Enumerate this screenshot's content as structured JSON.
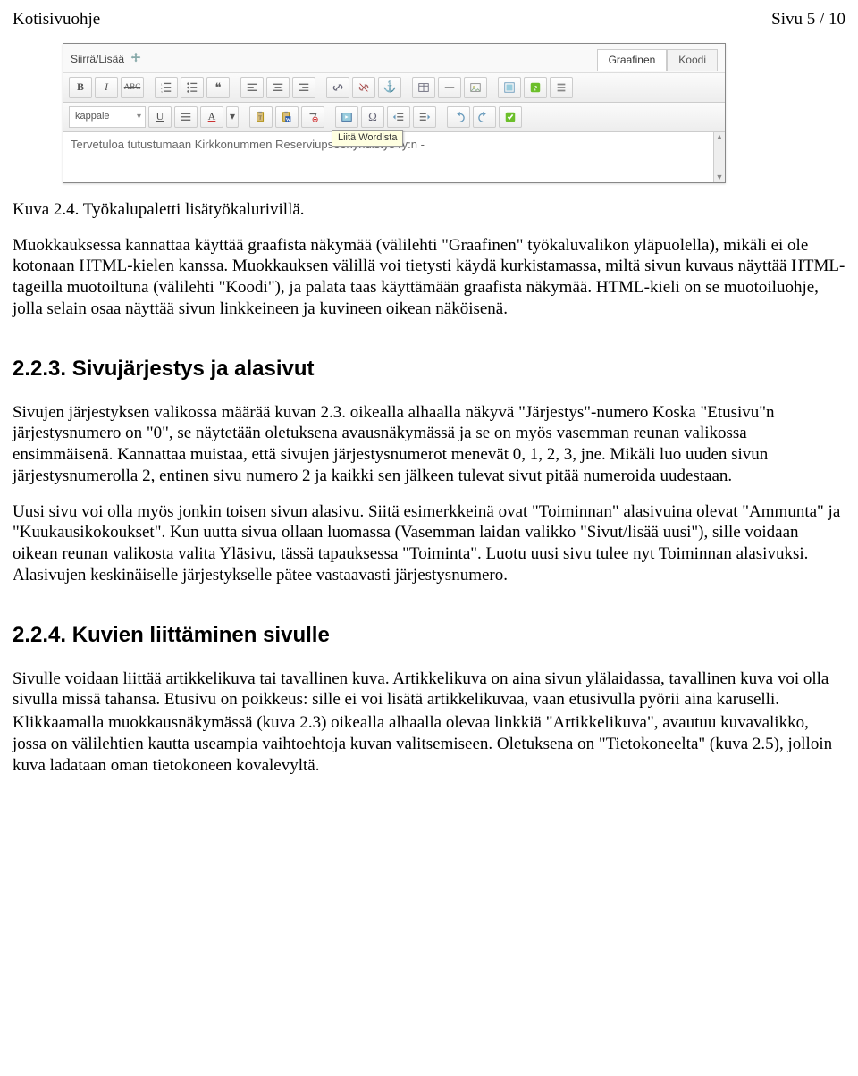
{
  "header": {
    "left": "Kotisivuohje",
    "right": "Sivu 5 / 10"
  },
  "editor": {
    "top_label": "Siirrä/Lisää",
    "tabs": {
      "graafinen": "Graafinen",
      "koodi": "Koodi"
    },
    "format_select": "kappale",
    "tooltip": "Liitä Wordista",
    "body_text": "Tervetuloa tutustumaan Kirkkonummen Reserviupseeriyhdistys ry:n -",
    "icons": {
      "bold": "B",
      "italic": "I",
      "strike": "ᴀʙꞆ",
      "ol": "≡",
      "ul": "≡",
      "quote": "❝",
      "link": "🔗",
      "anchor": "⚓",
      "unlink": "✕",
      "table": "▦",
      "hr": "—",
      "image": "▧",
      "underline": "U",
      "fontcolor": "A"
    }
  },
  "caption": "Kuva 2.4. Työkalupaletti lisätyökalurivillä.",
  "para1": "Muokkauksessa kannattaa käyttää graafista näkymää (välilehti \"Graafinen\" työkaluvalikon yläpuolella), mikäli ei ole kotonaan HTML-kielen kanssa. Muokkauksen välillä voi tietysti käydä kurkistamassa, miltä sivun kuvaus näyttää HTML-tageilla muotoiltuna (välilehti \"Koodi\"), ja palata taas käyttämään graafista näkymää. HTML-kieli on se muotoiluohje, jolla selain osaa näyttää sivun linkkeineen ja kuvineen oikean näköisenä.",
  "sec223": {
    "title": "2.2.3. Sivujärjestys ja alasivut"
  },
  "para2": "Sivujen järjestyksen valikossa määrää kuvan 2.3. oikealla alhaalla näkyvä \"Järjestys\"-numero Koska \"Etusivu\"n järjestysnumero on \"0\", se näytetään oletuksena avausnäkymässä ja se on myös vasemman reunan valikossa ensimmäisenä. Kannattaa muistaa, että sivujen järjestysnumerot menevät 0, 1, 2, 3, jne. Mikäli luo uuden sivun järjestysnumerolla 2, entinen sivu numero 2 ja kaikki sen jälkeen tulevat sivut pitää numeroida uudestaan.",
  "para3": "Uusi sivu voi olla myös jonkin toisen sivun alasivu. Siitä esimerkkeinä ovat \"Toiminnan\" alasivuina olevat \"Ammunta\" ja \"Kuukausikokoukset\". Kun uutta sivua ollaan luomassa (Vasemman laidan valikko \"Sivut/lisää uusi\"), sille voidaan oikean reunan valikosta valita Yläsivu, tässä tapauksessa \"Toiminta\". Luotu uusi sivu tulee nyt Toiminnan alasivuksi. Alasivujen keskinäiselle järjestykselle pätee vastaavasti järjestysnumero.",
  "sec224": {
    "title": "2.2.4. Kuvien liittäminen sivulle"
  },
  "para4": "Sivulle voidaan liittää artikkelikuva tai tavallinen kuva. Artikkelikuva on aina sivun ylälaidassa, tavallinen kuva voi olla sivulla missä tahansa. Etusivu on poikkeus: sille ei voi lisätä artikkelikuvaa, vaan etusivulla pyörii aina karuselli.",
  "para5": "Klikkaamalla muokkausnäkymässä (kuva 2.3) oikealla alhaalla olevaa linkkiä \"Artikkelikuva\", avautuu kuvavalikko, jossa on välilehtien kautta useampia vaihtoehtoja kuvan valitsemiseen. Oletuksena on \"Tietokoneelta\" (kuva 2.5), jolloin kuva ladataan oman tietokoneen kovalevyltä."
}
